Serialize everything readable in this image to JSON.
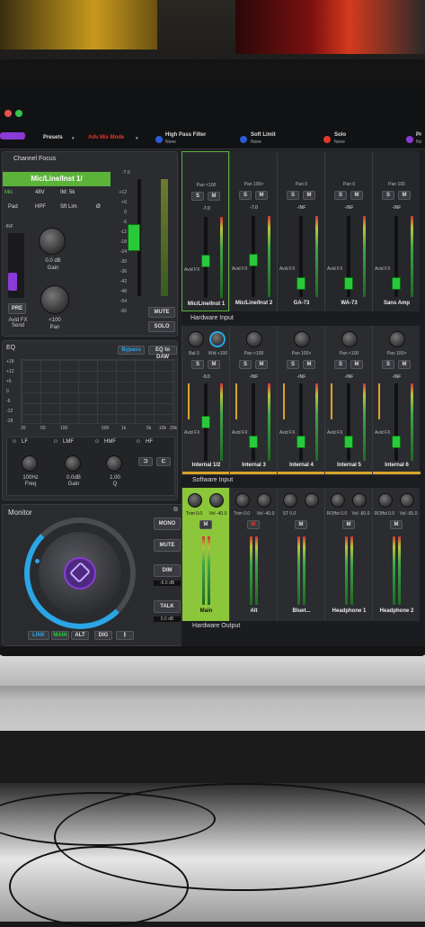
{
  "toolbar": {
    "presets": "Presets",
    "adv_mix_mode": "Adv Mix Mode",
    "hpf_label": "High Pass Filter",
    "hpf_value": "None",
    "soft_limit_label": "Soft Limit",
    "soft_limit_value": "None",
    "solo_label": "Solo",
    "solo_value": "None",
    "pr_label": "Pr",
    "pr_value": "No"
  },
  "channel_focus": {
    "title": "Channel Focus",
    "channel": "Mic/Line/Inst 1/",
    "mode": "Mic",
    "phantom": "48V",
    "impedance": "IM: 5k",
    "pad": "Pad",
    "hpf": "HPF",
    "sft_lim": "Sft Lim",
    "phase": "Ø",
    "gain_value": "0.0 dB",
    "gain_label": "Gain",
    "pre": "PRE",
    "avid_fx_send": "Avid FX Send",
    "pan_value": "<100",
    "pan_label": "Pan",
    "top_db": "-7.0",
    "mute": "MUTE",
    "solo": "SOLO",
    "meter_left": "-INF",
    "scale": [
      "+12",
      "+6",
      "0",
      "-6",
      "-12",
      "-18",
      "-24",
      "-30",
      "-36",
      "-42",
      "-48",
      "-54",
      "-60"
    ]
  },
  "eq": {
    "title": "EQ",
    "bypass": "Bypass",
    "eq_to_daw": "EQ to DAW",
    "y_ticks": [
      "+18",
      "+12",
      "+6",
      "0",
      "-6",
      "-12",
      "-18"
    ],
    "x_ticks": [
      "20",
      "50",
      "100",
      "500",
      "1k",
      "5k",
      "10k",
      "20k"
    ],
    "bands": [
      "LF",
      "LMF",
      "HMF",
      "HF"
    ],
    "freq_value": "100Hz",
    "freq_label": "Freq",
    "gain_value": "0.0dB",
    "gain_label": "Gain",
    "q_value": "1.00",
    "q_label": "Q"
  },
  "monitor": {
    "title": "Monitor",
    "mono": "MONO",
    "mute": "MUTE",
    "dim": "DIM",
    "dim_value": "-6.0 dB",
    "talk": "TALK",
    "talk_value": "0.0 dB",
    "link": "LINK",
    "main": "MAIN",
    "alt": "ALT",
    "dig": "DIG"
  },
  "inputs_top": [
    {
      "name": "Mic/Line/Inst 1",
      "pan": "Pan <100",
      "level": "-7.0",
      "fx": "Avid FX",
      "fader": 0.45
    },
    {
      "name": "Mic/Line/Inst 2",
      "pan": "Pan 100>",
      "level": "-7.0",
      "fx": "Avid FX",
      "fader": 0.45
    },
    {
      "name": "GA-73",
      "pan": "Pan 0",
      "level": "-INF",
      "fx": "Avid FX",
      "fader": 0.1
    },
    {
      "name": "WA-73",
      "pan": "Pan 0",
      "level": "-INF",
      "fx": "Avid FX",
      "fader": 0.1
    },
    {
      "name": "Sans Amp",
      "pan": "Pan 100",
      "level": "-INF",
      "fx": "Avid FX",
      "fader": 0.1
    }
  ],
  "hardware_input": {
    "title": "Hardware Input",
    "channels": [
      {
        "name": "Internal 1/2",
        "pan": "Bal 0",
        "width": "Wid +100",
        "level": "-9.0",
        "fx": "Avid FX",
        "fader": 0.5
      },
      {
        "name": "Internal 3",
        "pan": "Pan <100",
        "level": "-INF",
        "fx": "Avid FX",
        "fader": 0.2
      },
      {
        "name": "Internal 4",
        "pan": "Pan 100>",
        "level": "-INF",
        "fx": "Avid FX",
        "fader": 0.2
      },
      {
        "name": "Internal 5",
        "pan": "Pan <100",
        "level": "-INF",
        "fx": "Avid FX",
        "fader": 0.2
      },
      {
        "name": "Internal 6",
        "pan": "Pan 100>",
        "level": "-INF",
        "fx": "Avid FX",
        "fader": 0.2
      }
    ]
  },
  "software_input": {
    "title": "Software Input",
    "channels": [
      {
        "name": "Main",
        "trim": "Trim 0.0",
        "vol": "Vol -40.0"
      },
      {
        "name": "Alt",
        "trim": "Trim 0.0",
        "vol": "Vol -40.0"
      },
      {
        "name": "Bluet...",
        "trim": "ST 0.0",
        "vol": ""
      },
      {
        "name": "Headphone 1",
        "trim": "ROffst 0.0",
        "vol": "Vol -60.0"
      },
      {
        "name": "Headphone 2",
        "trim": "ROffst 0.0",
        "vol": "Vol -65.0"
      }
    ]
  },
  "hardware_output": {
    "title": "Hardware Output"
  },
  "common": {
    "s": "S",
    "m": "M"
  },
  "colors": {
    "accent_green": "#29c93b",
    "accent_purple": "#8a3bd6",
    "accent_blue": "#2aa6e6",
    "mode_red": "#e2372b"
  }
}
